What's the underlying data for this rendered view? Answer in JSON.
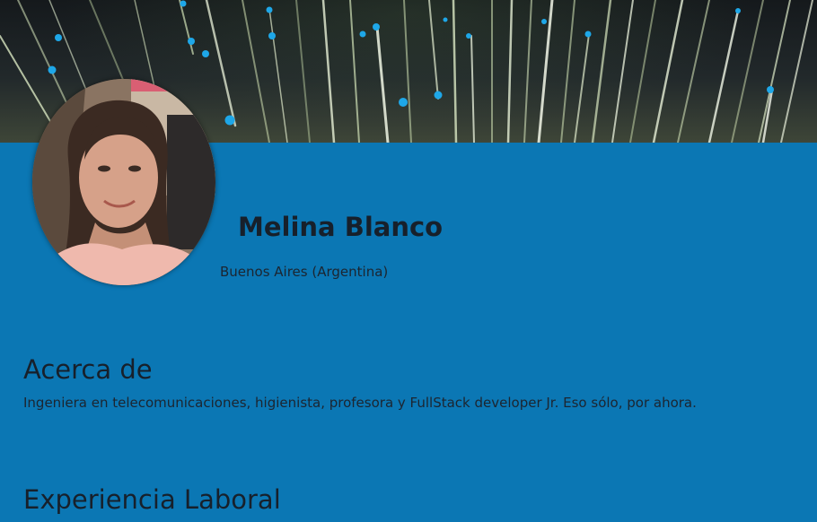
{
  "profile": {
    "name": "Melina Blanco",
    "location": "Buenos Aires (Argentina)"
  },
  "about": {
    "title": "Acerca de",
    "text": "Ingeniera en telecomunicaciones, higienista, profesora y FullStack developer Jr. Eso sólo, por ahora."
  },
  "experience": {
    "title": "Experiencia Laboral"
  },
  "colors": {
    "page_background": "#0b77b4",
    "text": "#17202b",
    "fiber_tip": "#1ea7e8"
  },
  "images": {
    "banner": "fiber-optic-lights-banner",
    "avatar": "profile-photo"
  }
}
